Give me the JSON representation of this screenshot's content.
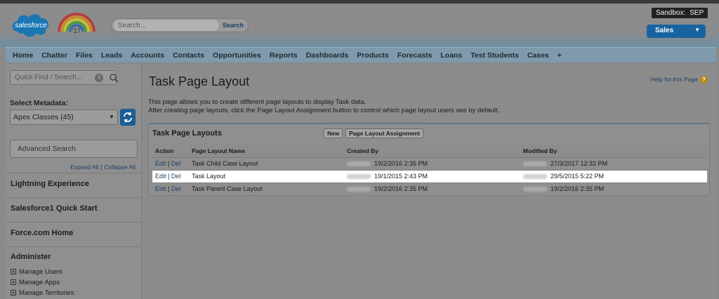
{
  "header": {
    "logo_text": "salesforce",
    "rainbow_badge": "'17",
    "search": {
      "placeholder": "Search...",
      "button": "Search"
    },
    "sandbox": {
      "label": "Sandbox:",
      "name": "SEP"
    },
    "app_switcher": "Sales"
  },
  "tabs": [
    "Home",
    "Chatter",
    "Files",
    "Leads",
    "Accounts",
    "Contacts",
    "Opportunities",
    "Reports",
    "Dashboards",
    "Products",
    "Forecasts",
    "Loans",
    "Test Students",
    "Cases",
    "+"
  ],
  "sidebar": {
    "quick_find_placeholder": "Quick Find / Search...",
    "select_metadata_label": "Select Metadata:",
    "select_metadata_value": "Apex Classes (45)",
    "advanced_search": "Advanced Search",
    "expand_all": "Expand All",
    "collapse_all": "Collapse All",
    "sections": [
      "Lightning Experience",
      "Salesforce1 Quick Start",
      "Force.com Home"
    ],
    "administer": {
      "title": "Administer",
      "items": [
        "Manage Users",
        "Manage Apps",
        "Manage Territories"
      ]
    }
  },
  "main": {
    "title": "Task Page Layout",
    "help": "Help for this Page",
    "desc_line1": "This page allows you to create different page layouts to display Task data.",
    "desc_line2": "After creating page layouts, click the Page Layout Assignment button to control which page layout users see by default.",
    "panel": {
      "title": "Task Page Layouts",
      "new_button": "New",
      "assignment_button": "Page Layout Assignment",
      "columns": [
        "Action",
        "Page Layout Name",
        "Created By",
        "Modified By"
      ],
      "edit_label": "Edit",
      "del_label": "Del",
      "rows": [
        {
          "name": "Task Child Case Layout",
          "created": "19/2/2016 2:35 PM",
          "modified": "27/3/2017 12:32 PM"
        },
        {
          "name": "Task Layout",
          "created": "19/1/2015 2:43 PM",
          "modified": "29/5/2015 5:22 PM"
        },
        {
          "name": "Task Parent Case Layout",
          "created": "19/2/2016 2:35 PM",
          "modified": "19/2/2016 2:35 PM"
        }
      ]
    }
  },
  "colors": {
    "brand_blue": "#1763a0",
    "link": "#1d3f66",
    "help_icon": "#b58a16"
  },
  "icons": [
    "salesforce-logo-icon",
    "rainbow-17-icon",
    "info-icon",
    "search-icon",
    "refresh-icon",
    "chevron-down-icon",
    "expand-arrow-icon",
    "help-icon"
  ]
}
